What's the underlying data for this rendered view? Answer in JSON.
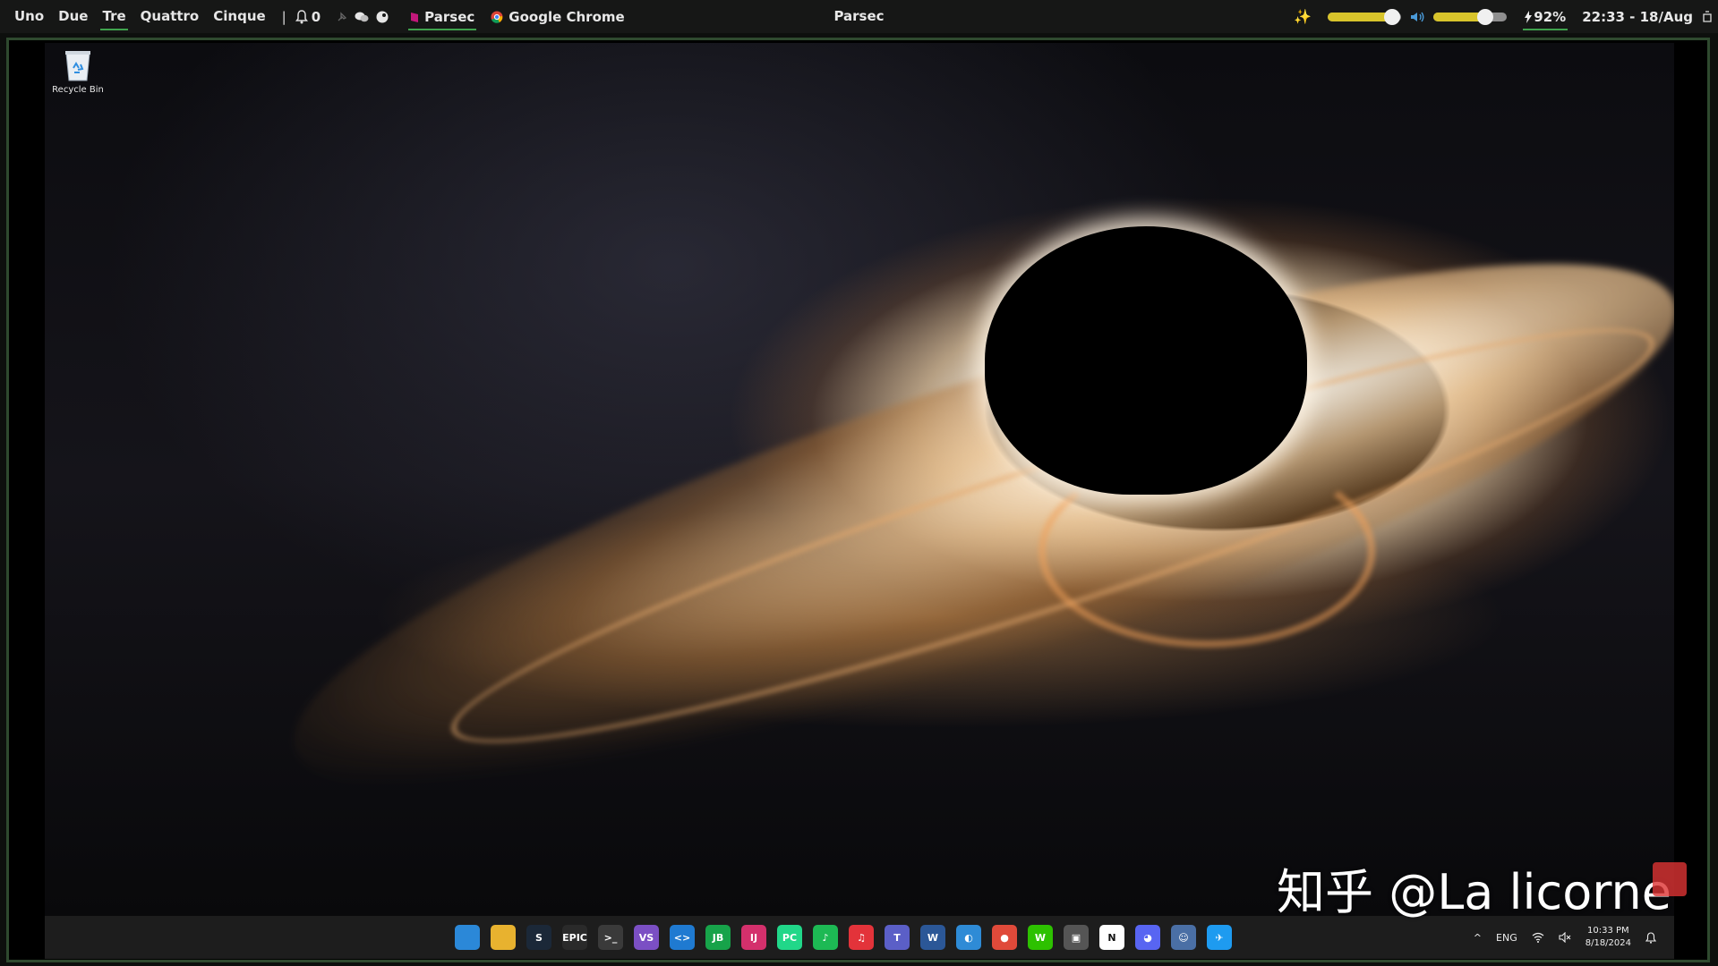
{
  "topbar": {
    "workspaces": [
      "Uno",
      "Due",
      "Tre",
      "Quattro",
      "Cinque"
    ],
    "active_workspace_index": 2,
    "separator": "|",
    "notification_count": "0",
    "tasks": [
      {
        "label": "Parsec",
        "icon": "parsec-icon"
      },
      {
        "label": "Google Chrome",
        "icon": "chrome-icon"
      }
    ],
    "window_title": "Parsec",
    "brightness_level": 0.88,
    "volume_level": 0.7,
    "battery": "92%",
    "datetime": "22:33 - 18/Aug"
  },
  "desktop": {
    "recycle_bin_label": "Recycle Bin",
    "watermark": "知乎 @La licorne"
  },
  "taskbar": {
    "apps": [
      {
        "name": "start-icon",
        "glyph": "",
        "color": "#2b88d8"
      },
      {
        "name": "file-explorer-icon",
        "glyph": "",
        "color": "#e8b22f"
      },
      {
        "name": "steam-icon",
        "glyph": "S",
        "color": "#1b2838"
      },
      {
        "name": "epic-games-icon",
        "glyph": "EPIC",
        "color": "#2a2a2a"
      },
      {
        "name": "terminal-icon",
        "glyph": ">_",
        "color": "#3a3a3a"
      },
      {
        "name": "visual-studio-icon",
        "glyph": "VS",
        "color": "#7b4fc4"
      },
      {
        "name": "vscode-icon",
        "glyph": "<>",
        "color": "#1f7ad1"
      },
      {
        "name": "jetbrains-toolbox-icon",
        "glyph": "JB",
        "color": "#17a34a"
      },
      {
        "name": "intellij-icon",
        "glyph": "IJ",
        "color": "#d4306c"
      },
      {
        "name": "pycharm-icon",
        "glyph": "PC",
        "color": "#21d789"
      },
      {
        "name": "spotify-icon",
        "glyph": "♪",
        "color": "#1db954"
      },
      {
        "name": "netease-music-icon",
        "glyph": "♫",
        "color": "#e3333a"
      },
      {
        "name": "teams-icon",
        "glyph": "T",
        "color": "#5b5fc7"
      },
      {
        "name": "word-icon",
        "glyph": "W",
        "color": "#2b5797"
      },
      {
        "name": "clipchamp-icon",
        "glyph": "◐",
        "color": "#2e8bd6"
      },
      {
        "name": "chrome-icon",
        "glyph": "●",
        "color": "#e04a3a"
      },
      {
        "name": "wechat-icon",
        "glyph": "W",
        "color": "#2dc100"
      },
      {
        "name": "photos-icon",
        "glyph": "▣",
        "color": "#555"
      },
      {
        "name": "notion-icon",
        "glyph": "N",
        "color": "#ffffff"
      },
      {
        "name": "discord-icon",
        "glyph": "◕",
        "color": "#5865f2"
      },
      {
        "name": "bot-icon",
        "glyph": "☺",
        "color": "#4a6fa5"
      },
      {
        "name": "qq-icon",
        "glyph": "✈",
        "color": "#1e9bf0"
      }
    ],
    "tray": {
      "chevron": "^",
      "language": "ENG",
      "time": "10:33 PM",
      "date": "8/18/2024"
    }
  },
  "colors": {
    "active_underline": "#3fa34d",
    "slider_fill": "#d8c42b",
    "frame_border": "#2f4a2f"
  }
}
